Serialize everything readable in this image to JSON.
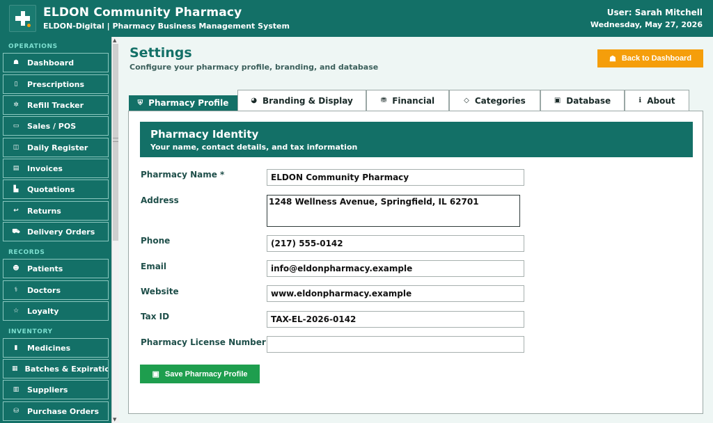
{
  "header": {
    "title": "ELDON Community Pharmacy",
    "subtitle": "ELDON-Digital  |  Pharmacy Business Management System",
    "user": "User: Sarah Mitchell",
    "date": "Wednesday, May 27, 2026"
  },
  "sidebar": {
    "sections": {
      "operations": "OPERATIONS",
      "records": "RECORDS",
      "inventory": "INVENTORY"
    },
    "items": [
      {
        "label": "Dashboard",
        "icon": "home-icon",
        "glyph": "☗"
      },
      {
        "label": "Prescriptions",
        "icon": "clipboard-icon",
        "glyph": "▯"
      },
      {
        "label": "Refill Tracker",
        "icon": "refill-icon",
        "glyph": "✲"
      },
      {
        "label": "Sales / POS",
        "icon": "register-icon",
        "glyph": "▭"
      },
      {
        "label": "Daily Register",
        "icon": "ledger-icon",
        "glyph": "◫"
      },
      {
        "label": "Invoices",
        "icon": "invoice-icon",
        "glyph": "▤"
      },
      {
        "label": "Quotations",
        "icon": "quote-icon",
        "glyph": "▙"
      },
      {
        "label": "Returns",
        "icon": "return-icon",
        "glyph": "↩"
      },
      {
        "label": "Delivery Orders",
        "icon": "truck-icon",
        "glyph": "⛟"
      },
      {
        "label": "Patients",
        "icon": "people-icon",
        "glyph": "☻"
      },
      {
        "label": "Doctors",
        "icon": "stethoscope-icon",
        "glyph": "⚕"
      },
      {
        "label": "Loyalty",
        "icon": "star-icon",
        "glyph": "☆"
      },
      {
        "label": "Medicines",
        "icon": "pill-icon",
        "glyph": "▮"
      },
      {
        "label": "Batches & Expiration",
        "icon": "box-icon",
        "glyph": "▦"
      },
      {
        "label": "Suppliers",
        "icon": "building-icon",
        "glyph": "▥"
      },
      {
        "label": "Purchase Orders",
        "icon": "bag-icon",
        "glyph": "⛁"
      }
    ]
  },
  "page": {
    "title": "Settings",
    "description": "Configure your pharmacy profile, branding, and database",
    "back_button": "Back to Dashboard"
  },
  "tabs": [
    {
      "label": "Pharmacy Profile",
      "icon": "pharmacy-icon",
      "glyph": "⛨"
    },
    {
      "label": "Branding & Display",
      "icon": "palette-icon",
      "glyph": "◕"
    },
    {
      "label": "Financial",
      "icon": "money-bag-icon",
      "glyph": "⛃"
    },
    {
      "label": "Categories",
      "icon": "tag-icon",
      "glyph": "◇"
    },
    {
      "label": "Database",
      "icon": "floppy-icon",
      "glyph": "▣"
    },
    {
      "label": "About",
      "icon": "info-icon",
      "glyph": "ℹ"
    }
  ],
  "panel": {
    "title": "Pharmacy Identity",
    "subtitle": "Your name, contact details, and tax information"
  },
  "form": {
    "name_label": "Pharmacy Name *",
    "name_value": "ELDON Community Pharmacy",
    "address_label": "Address",
    "address_value": "1248 Wellness Avenue, Springfield, IL 62701",
    "phone_label": "Phone",
    "phone_value": "(217) 555-0142",
    "email_label": "Email",
    "email_value": "info@eldonpharmacy.example",
    "website_label": "Website",
    "website_value": "www.eldonpharmacy.example",
    "taxid_label": "Tax ID",
    "taxid_value": "TAX-EL-2026-0142",
    "license_label": "Pharmacy License Number",
    "license_value": "",
    "save_button": "Save Pharmacy Profile"
  },
  "colors": {
    "primary": "#137067",
    "accent": "#f59e0b",
    "save": "#1e9e4e"
  }
}
